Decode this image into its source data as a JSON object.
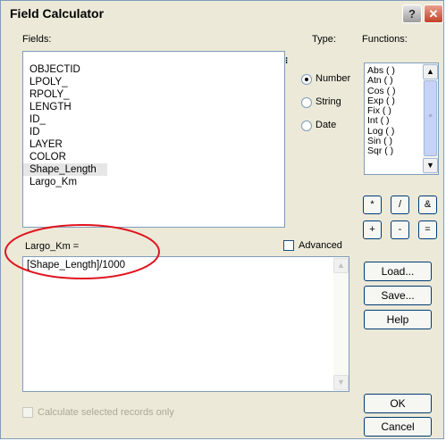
{
  "window": {
    "title": "Field Calculator",
    "help_glyph": "?",
    "close_glyph": "✕"
  },
  "fields": {
    "label": "Fields:",
    "items": [
      "OBJECTID",
      "LPOLY_",
      "RPOLY_",
      "LENGTH",
      "ID_",
      "ID",
      "LAYER",
      "COLOR",
      "Shape_Length",
      "Largo_Km"
    ],
    "selected": "Shape_Length",
    "scroll_glyph": "⁝"
  },
  "type": {
    "label": "Type:",
    "options": [
      "Number",
      "String",
      "Date"
    ],
    "selected": "Number"
  },
  "functions": {
    "label": "Functions:",
    "items": [
      "Abs ( )",
      "Atn ( )",
      "Cos ( )",
      "Exp ( )",
      "Fix ( )",
      "Int ( )",
      "Log ( )",
      "Sin ( )",
      "Sqr ( )"
    ]
  },
  "operators": {
    "row1": [
      "*",
      "/",
      "&"
    ],
    "row2": [
      "+",
      "-",
      "="
    ]
  },
  "expression": {
    "label": "Largo_Km =",
    "value": "[Shape_Length]/1000"
  },
  "advanced": {
    "label": "Advanced",
    "checked": false
  },
  "buttons": {
    "load": "Load...",
    "save": "Save...",
    "help": "Help",
    "ok": "OK",
    "cancel": "Cancel"
  },
  "selected_only": {
    "label": "Calculate selected records only",
    "enabled": false
  },
  "annotation": {
    "color": "#e0141e"
  }
}
